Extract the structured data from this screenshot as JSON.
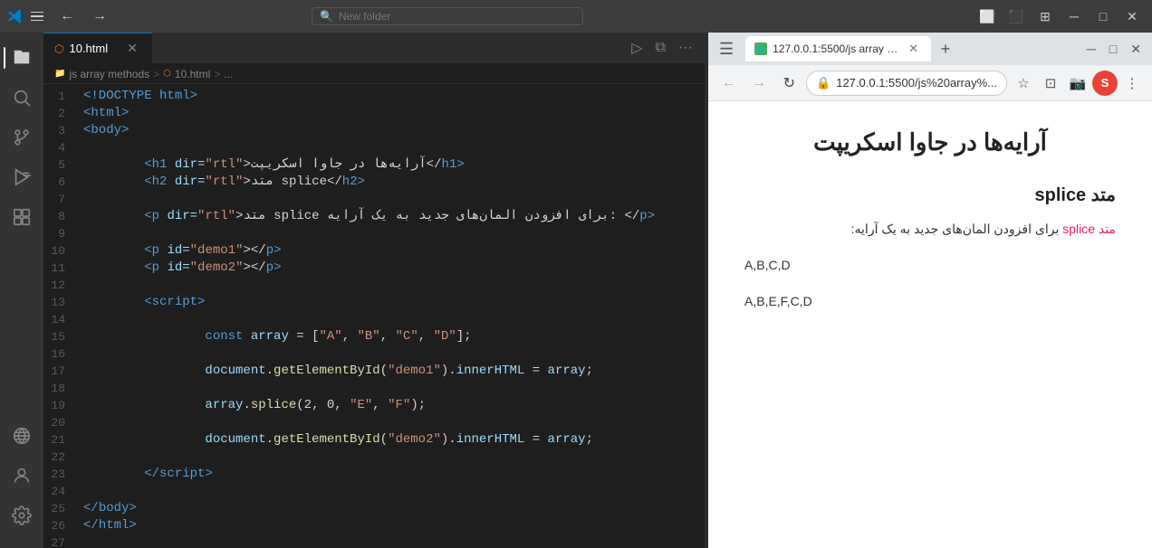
{
  "titlebar": {
    "search_placeholder": "New folder",
    "back_label": "←",
    "forward_label": "→",
    "layout_icons": [
      "⬜",
      "⬛",
      "⊞"
    ],
    "min_label": "─",
    "max_label": "□",
    "close_label": "✕"
  },
  "activity_bar": {
    "items": [
      {
        "name": "explorer",
        "icon": "⊞",
        "active": true
      },
      {
        "name": "search",
        "icon": "🔍"
      },
      {
        "name": "source-control",
        "icon": "⑂"
      },
      {
        "name": "run-debug",
        "icon": "▷"
      },
      {
        "name": "extensions",
        "icon": "⊟"
      },
      {
        "name": "remote",
        "icon": "○"
      },
      {
        "name": "account",
        "icon": "👤"
      },
      {
        "name": "settings",
        "icon": "⚙"
      }
    ]
  },
  "tabs": [
    {
      "label": "10.html",
      "active": true
    }
  ],
  "tab_actions": {
    "run_icon": "▷",
    "split_icon": "⧉",
    "more_icon": "···"
  },
  "breadcrumb": {
    "path": [
      "js array methods",
      ">",
      "10.html",
      ">",
      "..."
    ]
  },
  "code_lines": [
    {
      "num": 1,
      "content": [
        {
          "text": "<!DOCTYPE ",
          "class": "c-tag"
        },
        {
          "text": "html",
          "class": "c-blue"
        },
        {
          "text": ">",
          "class": "c-tag"
        }
      ]
    },
    {
      "num": 2,
      "content": [
        {
          "text": "<",
          "class": "c-tag"
        },
        {
          "text": "html",
          "class": "c-blue"
        },
        {
          "text": ">",
          "class": "c-tag"
        }
      ]
    },
    {
      "num": 3,
      "content": [
        {
          "text": "<",
          "class": "c-tag"
        },
        {
          "text": "body",
          "class": "c-blue"
        },
        {
          "text": ">",
          "class": "c-tag"
        }
      ]
    },
    {
      "num": 4,
      "content": []
    },
    {
      "num": 5,
      "content": [
        {
          "text": "        <",
          "class": "c-tag"
        },
        {
          "text": "h1 ",
          "class": "c-blue"
        },
        {
          "text": "dir=",
          "class": "c-attr"
        },
        {
          "text": "\"rtl\"",
          "class": "c-val"
        },
        {
          "text": ">آرایه‌ها در جاوا اسکریپت</",
          "class": "c-white"
        },
        {
          "text": "h1",
          "class": "c-blue"
        },
        {
          "text": ">",
          "class": "c-tag"
        }
      ]
    },
    {
      "num": 6,
      "content": [
        {
          "text": "        <",
          "class": "c-tag"
        },
        {
          "text": "h2 ",
          "class": "c-blue"
        },
        {
          "text": "dir=",
          "class": "c-attr"
        },
        {
          "text": "\"rtl\"",
          "class": "c-val"
        },
        {
          "text": ">متد splice</",
          "class": "c-white"
        },
        {
          "text": "h2",
          "class": "c-blue"
        },
        {
          "text": ">",
          "class": "c-tag"
        }
      ]
    },
    {
      "num": 7,
      "content": []
    },
    {
      "num": 8,
      "content": [
        {
          "text": "        <",
          "class": "c-tag"
        },
        {
          "text": "p ",
          "class": "c-blue"
        },
        {
          "text": "dir=",
          "class": "c-attr"
        },
        {
          "text": "\"rtl\"",
          "class": "c-val"
        },
        {
          "text": ">متد splice برای افزودن المان‌های جدید به یک آرایه: </",
          "class": "c-white"
        },
        {
          "text": "p",
          "class": "c-blue"
        },
        {
          "text": ">",
          "class": "c-tag"
        }
      ]
    },
    {
      "num": 9,
      "content": []
    },
    {
      "num": 10,
      "content": [
        {
          "text": "        <",
          "class": "c-tag"
        },
        {
          "text": "p ",
          "class": "c-blue"
        },
        {
          "text": "id=",
          "class": "c-attr"
        },
        {
          "text": "\"demo1\"",
          "class": "c-val"
        },
        {
          "text": "></",
          "class": "c-white"
        },
        {
          "text": "p",
          "class": "c-blue"
        },
        {
          "text": ">",
          "class": "c-tag"
        }
      ]
    },
    {
      "num": 11,
      "content": [
        {
          "text": "        <",
          "class": "c-tag"
        },
        {
          "text": "p ",
          "class": "c-blue"
        },
        {
          "text": "id=",
          "class": "c-attr"
        },
        {
          "text": "\"demo2\"",
          "class": "c-val"
        },
        {
          "text": "></",
          "class": "c-white"
        },
        {
          "text": "p",
          "class": "c-blue"
        },
        {
          "text": ">",
          "class": "c-tag"
        }
      ]
    },
    {
      "num": 12,
      "content": []
    },
    {
      "num": 13,
      "content": [
        {
          "text": "        <",
          "class": "c-tag"
        },
        {
          "text": "script",
          "class": "c-blue"
        },
        {
          "text": ">",
          "class": "c-tag"
        }
      ]
    },
    {
      "num": 14,
      "content": []
    },
    {
      "num": 15,
      "content": [
        {
          "text": "                ",
          "class": "c-white"
        },
        {
          "text": "const ",
          "class": "c-blue"
        },
        {
          "text": "array",
          "class": "c-lightblue"
        },
        {
          "text": " = [",
          "class": "c-white"
        },
        {
          "text": "\"A\"",
          "class": "c-orange"
        },
        {
          "text": ", ",
          "class": "c-white"
        },
        {
          "text": "\"B\"",
          "class": "c-orange"
        },
        {
          "text": ", ",
          "class": "c-white"
        },
        {
          "text": "\"C\"",
          "class": "c-orange"
        },
        {
          "text": ", ",
          "class": "c-white"
        },
        {
          "text": "\"D\"",
          "class": "c-orange"
        },
        {
          "text": "];",
          "class": "c-white"
        }
      ]
    },
    {
      "num": 16,
      "content": []
    },
    {
      "num": 17,
      "content": [
        {
          "text": "                ",
          "class": "c-white"
        },
        {
          "text": "document",
          "class": "c-lightblue"
        },
        {
          "text": ".",
          "class": "c-white"
        },
        {
          "text": "getElementById",
          "class": "c-yellow"
        },
        {
          "text": "(",
          "class": "c-white"
        },
        {
          "text": "\"demo1\"",
          "class": "c-orange"
        },
        {
          "text": ").",
          "class": "c-white"
        },
        {
          "text": "innerHTML",
          "class": "c-lightblue"
        },
        {
          "text": " = ",
          "class": "c-white"
        },
        {
          "text": "array",
          "class": "c-lightblue"
        },
        {
          "text": ";",
          "class": "c-white"
        }
      ]
    },
    {
      "num": 18,
      "content": []
    },
    {
      "num": 19,
      "content": [
        {
          "text": "                ",
          "class": "c-white"
        },
        {
          "text": "array",
          "class": "c-lightblue"
        },
        {
          "text": ".",
          "class": "c-white"
        },
        {
          "text": "splice",
          "class": "c-yellow"
        },
        {
          "text": "(2, 0, ",
          "class": "c-white"
        },
        {
          "text": "\"E\"",
          "class": "c-orange"
        },
        {
          "text": ", ",
          "class": "c-white"
        },
        {
          "text": "\"F\"",
          "class": "c-orange"
        },
        {
          "text": ");",
          "class": "c-white"
        }
      ]
    },
    {
      "num": 20,
      "content": []
    },
    {
      "num": 21,
      "content": [
        {
          "text": "                ",
          "class": "c-white"
        },
        {
          "text": "document",
          "class": "c-lightblue"
        },
        {
          "text": ".",
          "class": "c-white"
        },
        {
          "text": "getElementById",
          "class": "c-yellow"
        },
        {
          "text": "(",
          "class": "c-white"
        },
        {
          "text": "\"demo2\"",
          "class": "c-orange"
        },
        {
          "text": ").",
          "class": "c-white"
        },
        {
          "text": "innerHTML",
          "class": "c-lightblue"
        },
        {
          "text": " = ",
          "class": "c-white"
        },
        {
          "text": "array",
          "class": "c-lightblue"
        },
        {
          "text": ";",
          "class": "c-white"
        }
      ]
    },
    {
      "num": 22,
      "content": []
    },
    {
      "num": 23,
      "content": [
        {
          "text": "        </",
          "class": "c-tag"
        },
        {
          "text": "script",
          "class": "c-blue"
        },
        {
          "text": ">",
          "class": "c-tag"
        }
      ]
    },
    {
      "num": 24,
      "content": []
    },
    {
      "num": 25,
      "content": [
        {
          "text": "</",
          "class": "c-tag"
        },
        {
          "text": "body",
          "class": "c-blue"
        },
        {
          "text": ">",
          "class": "c-tag"
        }
      ]
    },
    {
      "num": 26,
      "content": [
        {
          "text": "</",
          "class": "c-tag"
        },
        {
          "text": "html",
          "class": "c-blue"
        },
        {
          "text": ">",
          "class": "c-tag"
        }
      ]
    },
    {
      "num": 27,
      "content": []
    }
  ],
  "browser": {
    "tab_title": "127.0.0.1:5500/js array metho...",
    "address": "127.0.0.1:5500/js%20array%...",
    "page_title": "آرایه‌ها در جاوا اسکریپت",
    "section_title": "متد splice",
    "description": "متد splice برای افزودن المان‌های جدید به یک آرایه:",
    "demo1": "A,B,C,D",
    "demo2": "A,B,E,F,C,D",
    "profile_initial": "S"
  }
}
